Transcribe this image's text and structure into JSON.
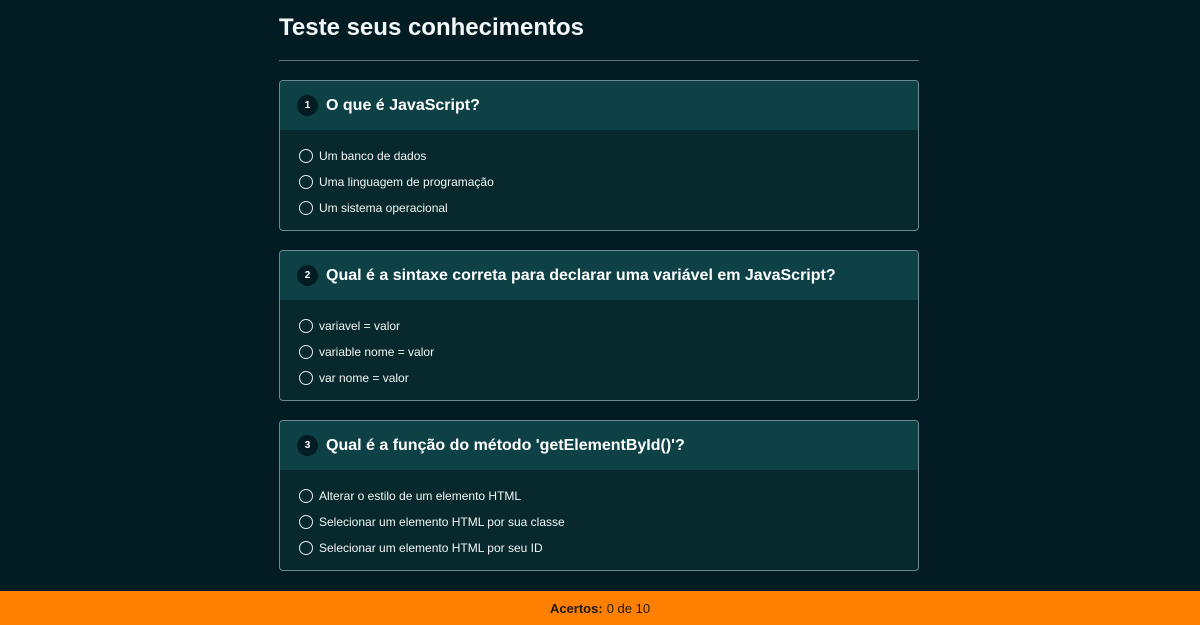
{
  "page": {
    "title": "Teste seus conhecimentos"
  },
  "questions": [
    {
      "number": "1",
      "text": "O que é JavaScript?",
      "options": [
        "Um banco de dados",
        "Uma linguagem de programação",
        "Um sistema operacional"
      ]
    },
    {
      "number": "2",
      "text": "Qual é a sintaxe correta para declarar uma variável em JavaScript?",
      "options": [
        "variavel = valor",
        "variable nome = valor",
        "var nome = valor"
      ]
    },
    {
      "number": "3",
      "text": "Qual é a função do método 'getElementById()'?",
      "options": [
        "Alterar o estilo de um elemento HTML",
        "Selecionar um elemento HTML por sua classe",
        "Selecionar um elemento HTML por seu ID"
      ]
    }
  ],
  "footer": {
    "label": "Acertos:",
    "value": "0 de 10"
  },
  "colors": {
    "background": "#031b22",
    "card_header": "#0d4146",
    "card_body": "#07292d",
    "footer": "#ff8000"
  }
}
